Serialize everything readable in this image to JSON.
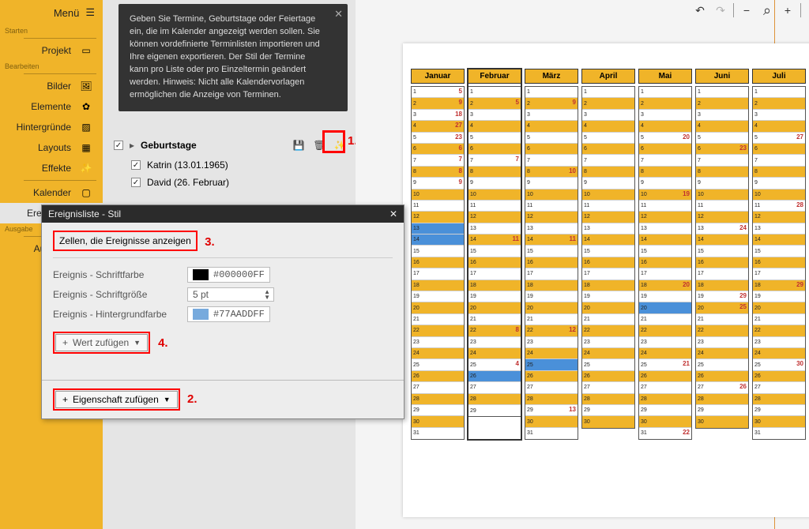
{
  "sidebar": {
    "menu": "Menü",
    "sections": {
      "starten": "Starten",
      "bearbeiten": "Bearbeiten",
      "ausgabe": "Ausgabe"
    },
    "items": {
      "projekt": "Projekt",
      "bilder": "Bilder",
      "elemente": "Elemente",
      "hintergruende": "Hintergründe",
      "layouts": "Layouts",
      "effekte": "Effekte",
      "kalender": "Kalender",
      "ereignisse": "Ereignisse",
      "ausgabe_item": "Ausgabe"
    }
  },
  "tooltip": {
    "text": "Geben Sie Termine, Geburtstage oder Feiertage ein, die im Kalender angezeigt werden sollen. Sie können vordefinierte Terminlisten importieren und Ihre eigenen exportieren. Der Stil der Termine kann pro Liste oder pro Einzeltermin geändert werden. Hinweis: Nicht alle Kalendervorlagen ermöglichen die Anzeige von Terminen."
  },
  "events": {
    "group_title": "Geburtstage",
    "items": [
      "Katrin (13.01.1965)",
      "David (26. Februar)"
    ],
    "callouts": {
      "one": "1."
    }
  },
  "dialog": {
    "title": "Ereignisliste - Stil",
    "section_cells": "Zellen, die Ereignisse anzeigen",
    "row_fontcolor": "Ereignis - Schriftfarbe",
    "val_fontcolor": "#000000FF",
    "swatch_fontcolor": "#000000",
    "row_fontsize": "Ereignis - Schriftgröße",
    "val_fontsize": "5 pt",
    "row_bgcolor": "Ereignis - Hintergrundfarbe",
    "val_bgcolor": "#77AADDFF",
    "swatch_bgcolor": "#77AADD",
    "btn_add_value": "Wert zufügen",
    "btn_add_prop": "Eigenschaft zufügen",
    "callouts": {
      "two": "2.",
      "three": "3.",
      "four": "4."
    }
  },
  "canvas": {
    "months": [
      "Januar",
      "Februar",
      "März",
      "April",
      "Mai",
      "Juni",
      "Juli"
    ],
    "month_lengths": [
      31,
      29,
      31,
      30,
      31,
      30,
      31
    ],
    "highlights": {
      "mark_numbers": {
        "Januar": {
          "1": 5,
          "2": 9,
          "3": 18,
          "4": 27,
          "5": 23,
          "6": 6,
          "7": 7,
          "8": 8,
          "9": 9,
          "_nums": []
        },
        "Februar": {
          "2": 5,
          "7": 7,
          "14": 11,
          "22": 8,
          "25": 4
        },
        "März": {
          "2": 9,
          "8": 10,
          "14": 11,
          "22": 12,
          "29": 13
        },
        "April": {},
        "Mai": {
          "5": 20,
          "10": 19,
          "18": 20,
          "25": 21,
          "31": 22
        },
        "Juni": {
          "6": 23,
          "13": 24,
          "19": 29,
          "20": 25,
          "27": 26
        },
        "Juli": {
          "5": 27,
          "11": 28,
          "18": 29,
          "25": 30
        }
      },
      "yellow_even_style": true,
      "blue_cells": {
        "Januar": [
          13,
          14
        ],
        "Februar": [
          26
        ],
        "März": [
          25
        ],
        "Mai": [
          20
        ]
      }
    }
  }
}
